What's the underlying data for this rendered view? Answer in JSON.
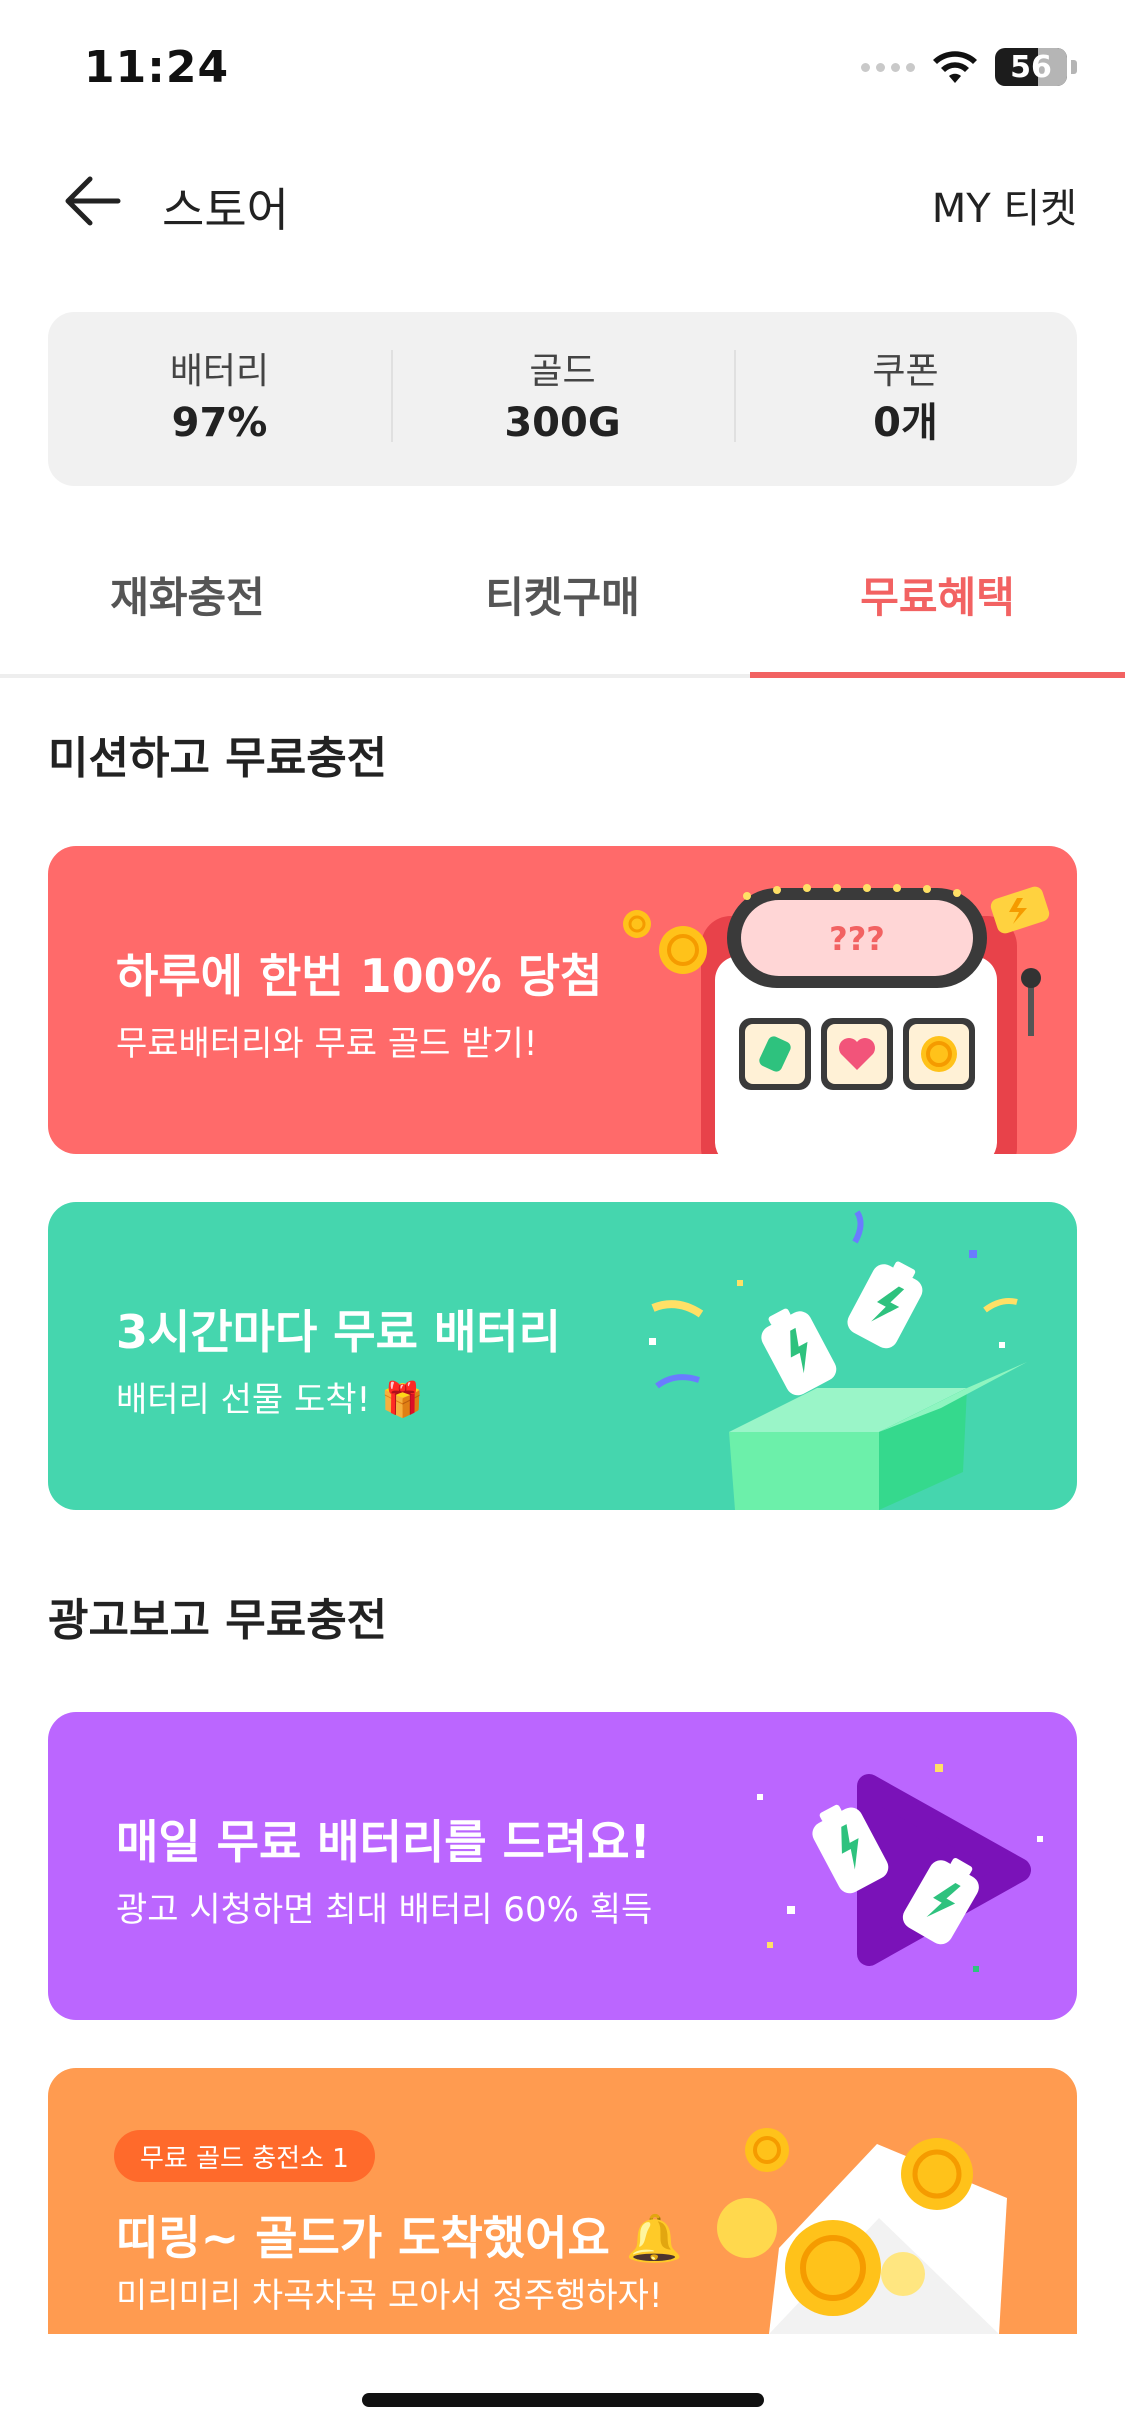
{
  "status_bar": {
    "time": "11:24",
    "battery_level": "56"
  },
  "header": {
    "title": "스토어",
    "my_ticket": "MY 티켓"
  },
  "summary": [
    {
      "label": "배터리",
      "value": "97%"
    },
    {
      "label": "골드",
      "value": "300G"
    },
    {
      "label": "쿠폰",
      "value": "0개"
    }
  ],
  "tabs": [
    {
      "label": "재화충전",
      "active": false
    },
    {
      "label": "티켓구매",
      "active": false
    },
    {
      "label": "무료혜택",
      "active": true
    }
  ],
  "sections": {
    "mission": {
      "title": "미션하고 무료충전"
    },
    "ads": {
      "title": "광고보고 무료충전"
    }
  },
  "banners": {
    "daily_slot": {
      "title": "하루에 한번 100% 당첨",
      "subtitle": "무료배터리와 무료 골드 받기!",
      "slot_text": "???"
    },
    "three_hours": {
      "title": "3시간마다 무료 배터리",
      "subtitle": "배터리 선물 도착! 🎁"
    },
    "daily_ad": {
      "title": "매일 무료 배터리를 드려요!",
      "subtitle": "광고 시청하면 최대 배터리 60% 획득"
    },
    "gold_station": {
      "badge": "무료 골드 충전소 1",
      "title": "띠링~ 골드가 도착했어요 🔔",
      "subtitle": "미리미리 차곡차곡 모아서 정주행하자!"
    }
  },
  "colors": {
    "accent": "#f26262",
    "banner_red": "#ff6a6a",
    "banner_green": "#45d6ae",
    "banner_purple": "#bb66ff",
    "banner_orange": "#ff9b50"
  }
}
